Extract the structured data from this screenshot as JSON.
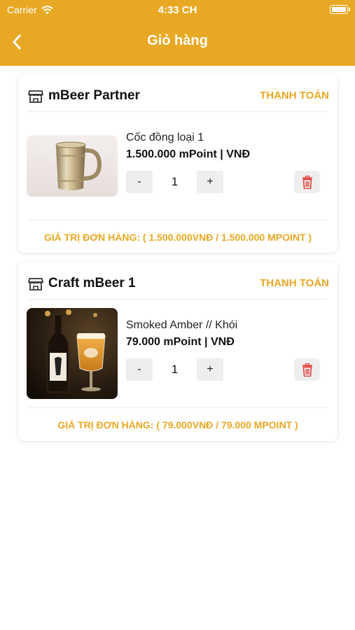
{
  "status_bar": {
    "carrier": "Carrier",
    "time": "4:33 CH"
  },
  "nav": {
    "title": "Giỏ hàng"
  },
  "colors": {
    "accent": "#E8A823",
    "delete": "#E53935"
  },
  "shops": [
    {
      "name": "mBeer Partner",
      "checkout_label": "THANH TOÁN",
      "item": {
        "name": "Cốc đồng loại 1",
        "price": "1.500.000 mPoint | VNĐ",
        "quantity": "1",
        "minus": "-",
        "plus": "+",
        "image": "copper-mug"
      },
      "total": "GIÁ TRỊ ĐƠN HÀNG: ( 1.500.000VNĐ / 1.500.000 MPOINT )"
    },
    {
      "name": "Craft mBeer 1",
      "checkout_label": "THANH TOÁN",
      "item": {
        "name": " Smoked Amber // Khói",
        "price": "79.000 mPoint | VNĐ",
        "quantity": "1",
        "minus": "-",
        "plus": "+",
        "image": "beer-bottle-glass"
      },
      "total": "GIÁ TRỊ ĐƠN HÀNG: ( 79.000VNĐ / 79.000 MPOINT )"
    }
  ]
}
